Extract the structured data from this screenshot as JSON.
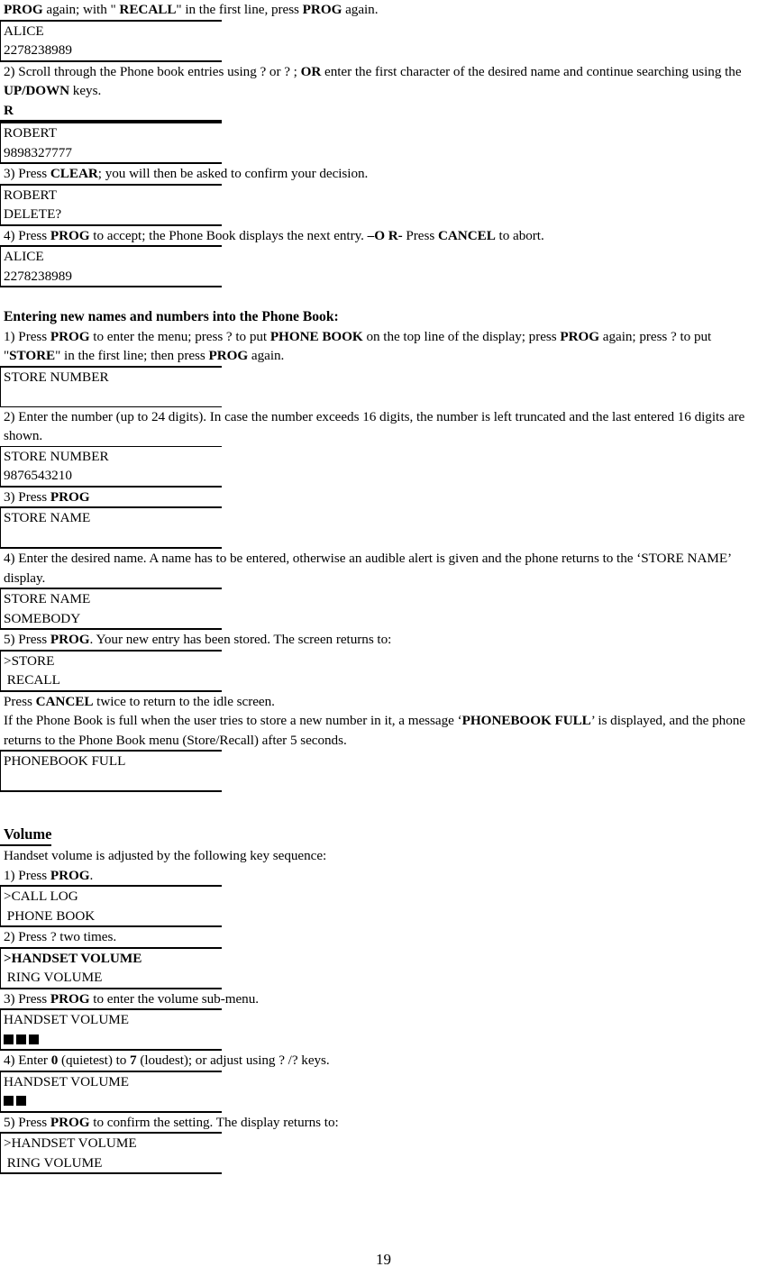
{
  "document": {
    "page_number": "19",
    "sections": [
      {
        "id": "recall-continued",
        "blocks": [
          {
            "type": "para",
            "id": "p-recall-prog",
            "runs": [
              {
                "t": "PROG",
                "b": true
              },
              {
                "t": " again; with \" ",
                "b": false
              },
              {
                "t": "RECALL",
                "b": true
              },
              {
                "t": "\" in the first line, press ",
                "b": false
              },
              {
                "t": "PROG",
                "b": true
              },
              {
                "t": " again.",
                "b": false
              }
            ]
          },
          {
            "type": "lcd",
            "id": "lcd-alice-1",
            "lines": [
              "ALICE",
              "2278238989"
            ]
          },
          {
            "type": "para",
            "id": "p-step2-scroll",
            "runs": [
              {
                "t": "2) Scroll through the Phone book entries using ?   or ?   ; ",
                "b": false
              },
              {
                "t": "OR",
                "b": true
              },
              {
                "t": " enter the first character of the desired name and continue searching using the ",
                "b": false
              },
              {
                "t": "UP/DOWN",
                "b": true
              },
              {
                "t": " keys.",
                "b": false
              }
            ]
          },
          {
            "type": "rline",
            "id": "rline-search-char",
            "text": "R"
          },
          {
            "type": "lcd",
            "id": "lcd-robert-1",
            "lines": [
              "ROBERT",
              "9898327777"
            ]
          },
          {
            "type": "para",
            "id": "p-step3-clear",
            "runs": [
              {
                "t": "3) Press ",
                "b": false
              },
              {
                "t": "CLEAR",
                "b": true
              },
              {
                "t": "; you will then be asked to confirm your decision.",
                "b": false
              }
            ]
          },
          {
            "type": "lcd",
            "id": "lcd-robert-delete",
            "lines": [
              "ROBERT",
              "DELETE?"
            ]
          },
          {
            "type": "para",
            "id": "p-step4-accept",
            "runs": [
              {
                "t": "4) Press ",
                "b": false
              },
              {
                "t": "PROG",
                "b": true
              },
              {
                "t": " to accept; the Phone Book displays the next entry. ",
                "b": false
              },
              {
                "t": "–O R-",
                "b": true
              },
              {
                "t": " Press ",
                "b": false
              },
              {
                "t": "CANCEL",
                "b": true
              },
              {
                "t": " to abort.",
                "b": false
              }
            ]
          },
          {
            "type": "lcd",
            "id": "lcd-alice-2",
            "lines": [
              "ALICE",
              "2278238989"
            ]
          }
        ]
      },
      {
        "id": "entering-new-names",
        "heading": "Entering new names and numbers into the Phone Book:",
        "blocks": [
          {
            "type": "para",
            "id": "p-store-step1",
            "runs": [
              {
                "t": "1) Press ",
                "b": false
              },
              {
                "t": "PROG",
                "b": true
              },
              {
                "t": " to enter the menu; press ?   to put ",
                "b": false
              },
              {
                "t": "PHONE BOOK",
                "b": true
              },
              {
                "t": " on the top line of the display; press ",
                "b": false
              },
              {
                "t": "PROG",
                "b": true
              },
              {
                "t": " again; press ?   to put \"",
                "b": false
              },
              {
                "t": "STORE",
                "b": true
              },
              {
                "t": "\" in the first line; then press ",
                "b": false
              },
              {
                "t": "PROG",
                "b": true
              },
              {
                "t": " again.",
                "b": false
              }
            ]
          },
          {
            "type": "lcd",
            "id": "lcd-store-number-empty",
            "lines": [
              "STORE NUMBER",
              ""
            ],
            "thin_bottom": true
          },
          {
            "type": "para",
            "id": "p-store-step2",
            "runs": [
              {
                "t": "2) Enter the number (up to 24 digits). In case the number exceeds 16 digits, the number is left truncated and the last entered 16 digits are shown.",
                "b": false
              }
            ]
          },
          {
            "type": "lcd",
            "id": "lcd-store-number-filled",
            "lines": [
              "STORE NUMBER",
              "9876543210"
            ],
            "thin_top": true
          },
          {
            "type": "para",
            "id": "p-store-step3",
            "runs": [
              {
                "t": "3) Press ",
                "b": false
              },
              {
                "t": "PROG",
                "b": true
              }
            ]
          },
          {
            "type": "lcd",
            "id": "lcd-store-name-empty",
            "lines": [
              "STORE NAME",
              ""
            ]
          },
          {
            "type": "para",
            "id": "p-store-step4",
            "runs": [
              {
                "t": "4) Enter the desired name. A name has to be entered, otherwise an audible alert is given and the phone returns to the ‘STORE NAME’ display.",
                "b": false
              }
            ]
          },
          {
            "type": "lcd",
            "id": "lcd-store-name-filled",
            "lines": [
              "STORE NAME",
              "SOMEBODY"
            ]
          },
          {
            "type": "para",
            "id": "p-store-step5",
            "runs": [
              {
                "t": "5) Press ",
                "b": false
              },
              {
                "t": "PROG",
                "b": true
              },
              {
                "t": ".  Your new entry has been stored.  The screen returns to:",
                "b": false
              }
            ]
          },
          {
            "type": "lcd",
            "id": "lcd-store-recall-menu",
            "lines": [
              ">STORE",
              " RECALL"
            ]
          },
          {
            "type": "para",
            "id": "p-press-cancel-twice",
            "runs": [
              {
                "t": "Press ",
                "b": false
              },
              {
                "t": "CANCEL",
                "b": true
              },
              {
                "t": " twice to return to the idle screen.",
                "b": false
              }
            ]
          },
          {
            "type": "para",
            "id": "p-phonebook-full-note",
            "runs": [
              {
                "t": "If the Phone Book is full when the user tries to store a new number in it, a message ‘",
                "b": false
              },
              {
                "t": "PHONEBOOK FULL",
                "b": true
              },
              {
                "t": "’ is displayed, and the phone returns to the Phone Book menu (Store/Recall) after 5 seconds.",
                "b": false
              }
            ]
          },
          {
            "type": "lcd",
            "id": "lcd-phonebook-full",
            "lines": [
              "PHONEBOOK FULL",
              ""
            ]
          }
        ]
      },
      {
        "id": "volume",
        "heading": "Volume ",
        "blocks": [
          {
            "type": "para",
            "id": "p-volume-intro",
            "runs": [
              {
                "t": "Handset volume is adjusted by the following key sequence:",
                "b": false
              }
            ]
          },
          {
            "type": "para",
            "id": "p-vol-step1",
            "runs": [
              {
                "t": "1) Press ",
                "b": false
              },
              {
                "t": "PROG",
                "b": true
              },
              {
                "t": ".",
                "b": false
              }
            ]
          },
          {
            "type": "lcd",
            "id": "lcd-main-menu",
            "lines": [
              ">CALL LOG",
              " PHONE BOOK"
            ]
          },
          {
            "type": "para",
            "id": "p-vol-step2",
            "runs": [
              {
                "t": "2) Press ?   two times.",
                "b": false
              }
            ]
          },
          {
            "type": "lcd",
            "id": "lcd-handset-ring-menu",
            "lines": [
              ">HANDSET VOLUME",
              " RING VOLUME"
            ],
            "bold_lines": [
              0
            ]
          },
          {
            "type": "para",
            "id": "p-vol-step3",
            "runs": [
              {
                "t": "3) Press ",
                "b": false
              },
              {
                "t": "PROG",
                "b": true
              },
              {
                "t": " to enter the volume sub-menu.",
                "b": false
              }
            ]
          },
          {
            "type": "lcd-bars",
            "id": "lcd-handset-volume-3",
            "label": "HANDSET VOLUME",
            "bars": 3
          },
          {
            "type": "para",
            "id": "p-vol-step4",
            "runs": [
              {
                "t": "4) Enter ",
                "b": false
              },
              {
                "t": "0",
                "b": true
              },
              {
                "t": " (quietest) to ",
                "b": false
              },
              {
                "t": "7",
                "b": true
              },
              {
                "t": " (loudest); or adjust using  ?  /?   keys.",
                "b": false
              }
            ]
          },
          {
            "type": "lcd-bars",
            "id": "lcd-handset-volume-2",
            "label": "HANDSET VOLUME",
            "bars": 2
          },
          {
            "type": "para",
            "id": "p-vol-step5",
            "runs": [
              {
                "t": "5) Press ",
                "b": false
              },
              {
                "t": "PROG",
                "b": true
              },
              {
                "t": " to confirm the setting.  The display returns to:",
                "b": false
              }
            ]
          },
          {
            "type": "lcd",
            "id": "lcd-handset-ring-menu-2",
            "lines": [
              ">HANDSET VOLUME",
              " RING VOLUME"
            ]
          }
        ]
      }
    ]
  }
}
